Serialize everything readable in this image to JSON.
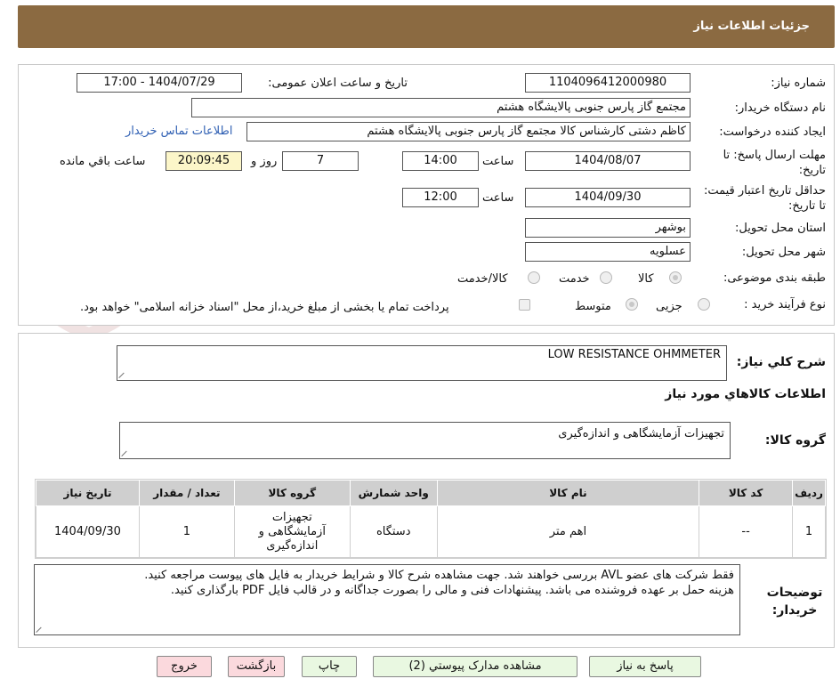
{
  "header": {
    "title": "جزئیات اطلاعات نیاز"
  },
  "fields": {
    "need_number_label": "شماره نیاز:",
    "need_number": "1104096412000980",
    "announce_label": "تاریخ و ساعت اعلان عمومی:",
    "announce_value": "1404/07/29 - 17:00",
    "buyer_org_label": "نام دستگاه خریدار:",
    "buyer_org": "مجتمع گاز پارس جنوبی  پالایشگاه هشتم",
    "creator_label": "ایجاد کننده درخواست:",
    "creator": "کاظم دشتی کارشناس کالا مجتمع گاز پارس جنوبی  پالایشگاه هشتم",
    "contact_link": "اطلاعات تماس خریدار",
    "reply_deadline_label": "مهلت ارسال پاسخ: تا تاریخ:",
    "reply_date": "1404/08/07",
    "time_label": "ساعت",
    "reply_time": "14:00",
    "days_value": "7",
    "days_label": "روز و",
    "remaining_time": "20:09:45",
    "remaining_label": "ساعت باقي مانده",
    "validity_label": "حداقل تاریخ اعتبار قیمت: تا تاریخ:",
    "validity_date": "1404/09/30",
    "validity_time": "12:00",
    "province_label": "استان محل تحویل:",
    "province": "بوشهر",
    "city_label": "شهر محل تحویل:",
    "city": "عسلویه",
    "category_label": "طبقه بندی موضوعی:",
    "category_options": [
      "کالا",
      "خدمت",
      "کالا/خدمت"
    ],
    "process_label": "نوع فرآیند خرید :",
    "process_options": [
      "جزیی",
      "متوسط"
    ],
    "payment_note": "پرداخت تمام یا بخشی از مبلغ خرید،از محل \"اسناد خزانه اسلامی\" خواهد بود."
  },
  "details": {
    "summary_label": "شرح کلي نياز:",
    "summary": "LOW RESISTANCE OHMMETER",
    "goods_info_title": "اطلاعات کالاهاي مورد نياز",
    "goods_group_label": "گروه کالا:",
    "goods_group": "تجهیزات آزمایشگاهی و اندازه‌گیری"
  },
  "table": {
    "headers": [
      "رديف",
      "کد کالا",
      "نام کالا",
      "واحد شمارش",
      "گروه کالا",
      "تعداد / مقدار",
      "تاریخ نیاز"
    ],
    "rows": [
      [
        "1",
        "--",
        "اهم متر",
        "دستگاه",
        "تجهیزات آزمایشگاهی و اندازه‌گیری",
        "1",
        "1404/09/30"
      ]
    ]
  },
  "notes": {
    "label": "توضیحات خریدار:",
    "line1": "فقط شرکت های عضو AVL بررسی خواهند شد. جهت مشاهده شرح کالا و شرایط خریدار به فایل های پیوست مراجعه کنید.",
    "line2": "هزینه حمل بر عهده فروشنده می باشد. پیشنهادات فنی و مالی را بصورت جداگانه و در قالب فایل PDF بارگذاری کنید."
  },
  "buttons": {
    "reply": "پاسخ به نیاز",
    "attachments": "مشاهده مدارک پیوستي (2)",
    "print": "چاپ",
    "back": "بازگشت",
    "exit": "خروج"
  },
  "watermark": {
    "text": "AriaTender.neT"
  },
  "colors": {
    "header": "#8b6a41",
    "link": "#2f5fb3",
    "highlight": "#fcf6c9",
    "btn_green": "#e9f8e1",
    "btn_pink": "#fbd9dd"
  }
}
